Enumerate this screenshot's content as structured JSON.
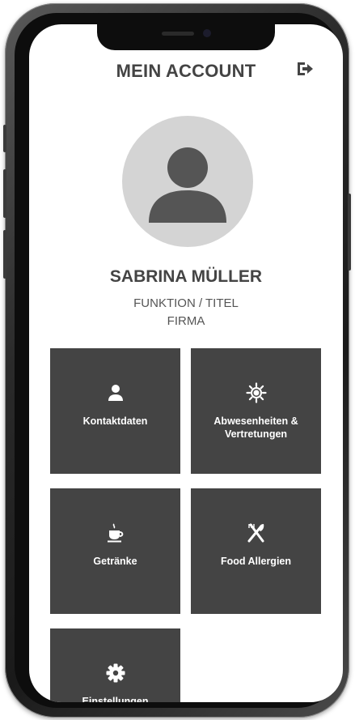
{
  "header": {
    "title": "MEIN ACCOUNT",
    "logout_icon": "logout-icon"
  },
  "profile": {
    "avatar_icon": "user-avatar-icon",
    "name": "SABRINA MÜLLER",
    "function": "FUNKTION / TITEL",
    "company": "FIRMA"
  },
  "tiles": [
    {
      "label": "Kontaktdaten",
      "icon": "person-icon"
    },
    {
      "label": "Abwesenheiten & Vertretungen",
      "icon": "sun-icon"
    },
    {
      "label": "Getränke",
      "icon": "coffee-icon"
    },
    {
      "label": "Food Allergien",
      "icon": "cutlery-icon"
    },
    {
      "label": "Einstellungen",
      "icon": "gear-icon"
    }
  ],
  "colors": {
    "tile_bg": "#444444",
    "text_dark": "#444444",
    "avatar_bg": "#d4d4d4",
    "avatar_fg": "#555555"
  }
}
